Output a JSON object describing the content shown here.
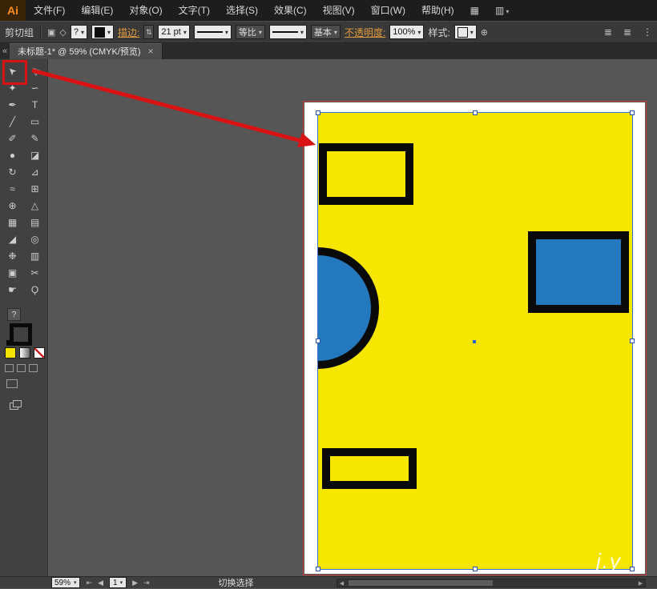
{
  "colors": {
    "artwork_yellow": "#f7e700",
    "shape_blue": "#2478bd",
    "selection_blue": "#2f62c4",
    "annotation_red": "#d91313",
    "artboard_outline_red": "#c63b3b"
  },
  "menubar": {
    "logo": "Ai",
    "items": [
      "文件(F)",
      "编辑(E)",
      "对象(O)",
      "文字(T)",
      "选择(S)",
      "效果(C)",
      "视图(V)",
      "窗口(W)",
      "帮助(H)"
    ],
    "icons": [
      {
        "name": "arrange-documents",
        "glyph": "▦"
      },
      {
        "name": "workspace-switcher",
        "glyph": "▥"
      }
    ]
  },
  "controlbar": {
    "context_label": "剪切组",
    "object_proxy_glyph": "▣",
    "anchor_glyph": "◇",
    "fill_combo_value": "?",
    "stroke_link": "描边:",
    "stepper_glyph": "⇅",
    "stroke_width": "21 pt",
    "profile_label": "等比",
    "brush_label": "基本",
    "opacity_link": "不透明度:",
    "opacity_value": "100%",
    "style_label": "样式:",
    "globe_glyph": "⊕",
    "right_icons": [
      {
        "name": "align-objects",
        "glyph": "≣"
      },
      {
        "name": "distribute-objects",
        "glyph": "≣"
      },
      {
        "name": "panel-menu",
        "glyph": "⋮"
      }
    ]
  },
  "tabbar": {
    "title": "未标题-1* @ 59% (CMYK/预览)"
  },
  "toolbar": {
    "help_glyph": "?",
    "tools": [
      {
        "name": "selection",
        "glyph": "➤"
      },
      {
        "name": "direct-selection",
        "glyph": "▷"
      },
      {
        "name": "magic-wand",
        "glyph": "✦"
      },
      {
        "name": "lasso",
        "glyph": "∽"
      },
      {
        "name": "pen",
        "glyph": "✒"
      },
      {
        "name": "type",
        "glyph": "T"
      },
      {
        "name": "line-segment",
        "glyph": "╱"
      },
      {
        "name": "rectangle",
        "glyph": "▭"
      },
      {
        "name": "paintbrush",
        "glyph": "✐"
      },
      {
        "name": "pencil",
        "glyph": "✎"
      },
      {
        "name": "blob-brush",
        "glyph": "●"
      },
      {
        "name": "eraser",
        "glyph": "◪"
      },
      {
        "name": "rotate",
        "glyph": "↻"
      },
      {
        "name": "scale",
        "glyph": "⊿"
      },
      {
        "name": "width",
        "glyph": "≈"
      },
      {
        "name": "free-transform",
        "glyph": "⊞"
      },
      {
        "name": "shape-builder",
        "glyph": "⊕"
      },
      {
        "name": "perspective-grid",
        "glyph": "△"
      },
      {
        "name": "mesh",
        "glyph": "▦"
      },
      {
        "name": "gradient",
        "glyph": "▤"
      },
      {
        "name": "eyedropper",
        "glyph": "◢"
      },
      {
        "name": "blend",
        "glyph": "◎"
      },
      {
        "name": "symbol-sprayer",
        "glyph": "❉"
      },
      {
        "name": "column-graph",
        "glyph": "▥"
      },
      {
        "name": "artboard",
        "glyph": "▣"
      },
      {
        "name": "slice",
        "glyph": "✂"
      },
      {
        "name": "hand",
        "glyph": "☛"
      },
      {
        "name": "zoom",
        "glyph": "Ϙ"
      }
    ]
  },
  "statusbar": {
    "zoom": "59%",
    "first_glyph": "⇤",
    "prev_glyph": "◀",
    "page": "1",
    "next_glyph": "▶",
    "last_glyph": "⇥",
    "status": "切换选择",
    "scroll_left_glyph": "◀",
    "scroll_right_glyph": "▶"
  },
  "watermark": {
    "text": "j.y"
  },
  "ui": {
    "dd": "▾",
    "close": "×",
    "collapse": "«"
  }
}
